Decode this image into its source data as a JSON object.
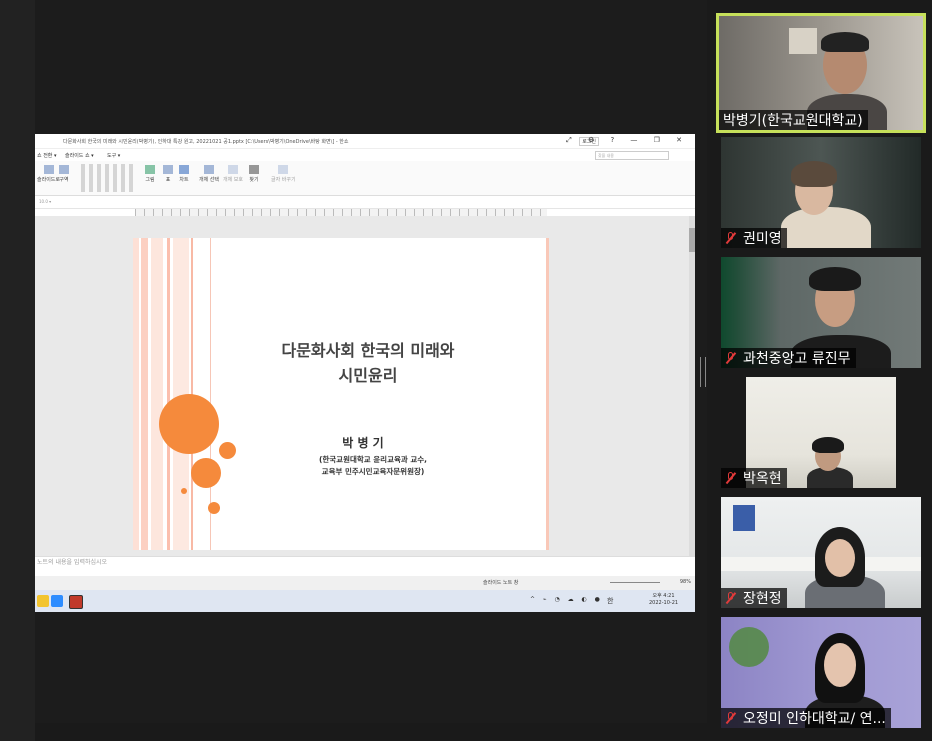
{
  "window": {
    "doc_title": "다문화사회 한국의 미래와 시민윤리(박병기), 인하대 특강 원고, 20221021 공1.pptx [C:\\Users\\박병기\\OneDrive\\바탕 화면\\] - 한쇼",
    "login": "로그인",
    "controls": "⤢ ⚙ ? — ❐ ✕"
  },
  "menu": {
    "items": [
      "쇼 전환 ▾",
      "슬라이드 쇼 ▾",
      "도구 ▾"
    ],
    "search_placeholder": "찾을 내용"
  },
  "ribbon": {
    "groups": [
      "슬라이드로",
      "구역",
      "그림",
      "표",
      "차트",
      "개체 선택",
      "개체 보호",
      "찾기",
      "글자 바꾸기"
    ]
  },
  "format_bar": "10.0 ▾",
  "slide": {
    "title_line1": "다문화사회 한국의 미래와",
    "title_line2": "시민윤리",
    "presenter": "박 병 기",
    "affiliation_line1": "(한국교원대학교 윤리교육과 교수,",
    "affiliation_line2": "교육부 민주시민교육자문위원장)"
  },
  "notes": {
    "placeholder": "노트의 내용을 입력하십시오"
  },
  "statusbar": {
    "view": "슬라이드 노트 창",
    "zoom": "98%"
  },
  "taskbar": {
    "lang": "한",
    "time": "오후 4:21",
    "date": "2022-10-21"
  },
  "participants": [
    {
      "name": "박병기(한국교원대학교)",
      "muted": false
    },
    {
      "name": "권미영",
      "muted": true
    },
    {
      "name": "과천중앙고 류진무",
      "muted": true
    },
    {
      "name": "박옥현",
      "muted": true
    },
    {
      "name": "장현정",
      "muted": true
    },
    {
      "name": "오정미 인하대학교/ 연...",
      "muted": true
    }
  ],
  "colors": {
    "accent_orange": "#f58a3c",
    "active_speaker": "#c6e05a",
    "muted_red": "#e03a3a"
  }
}
